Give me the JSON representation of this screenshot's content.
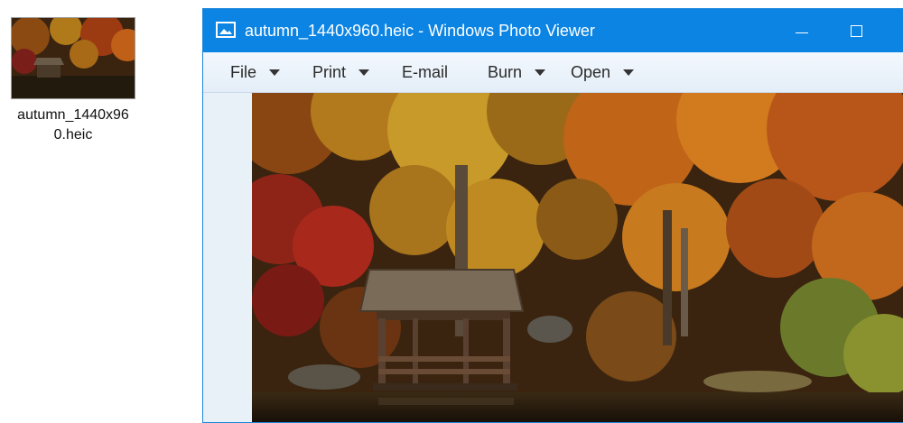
{
  "desktop": {
    "file": {
      "name": "autumn_1440x960.heic",
      "icon": "image-thumbnail"
    }
  },
  "window": {
    "title": "autumn_1440x960.heic - Windows Photo Viewer",
    "icon": "photo-viewer-icon",
    "controls": {
      "minimize": "minimize-icon",
      "maximize": "maximize-icon"
    },
    "menu": [
      {
        "label": "File",
        "dropdown": true
      },
      {
        "label": "Print",
        "dropdown": true
      },
      {
        "label": "E-mail",
        "dropdown": false
      },
      {
        "label": "Burn",
        "dropdown": true
      },
      {
        "label": "Open",
        "dropdown": true
      }
    ],
    "image": {
      "subject": "autumn-forest-with-gazebo"
    }
  },
  "colors": {
    "titlebar": "#0b84e4",
    "menubar": "#e4eef8",
    "viewer_bg": "#dde9f5"
  }
}
